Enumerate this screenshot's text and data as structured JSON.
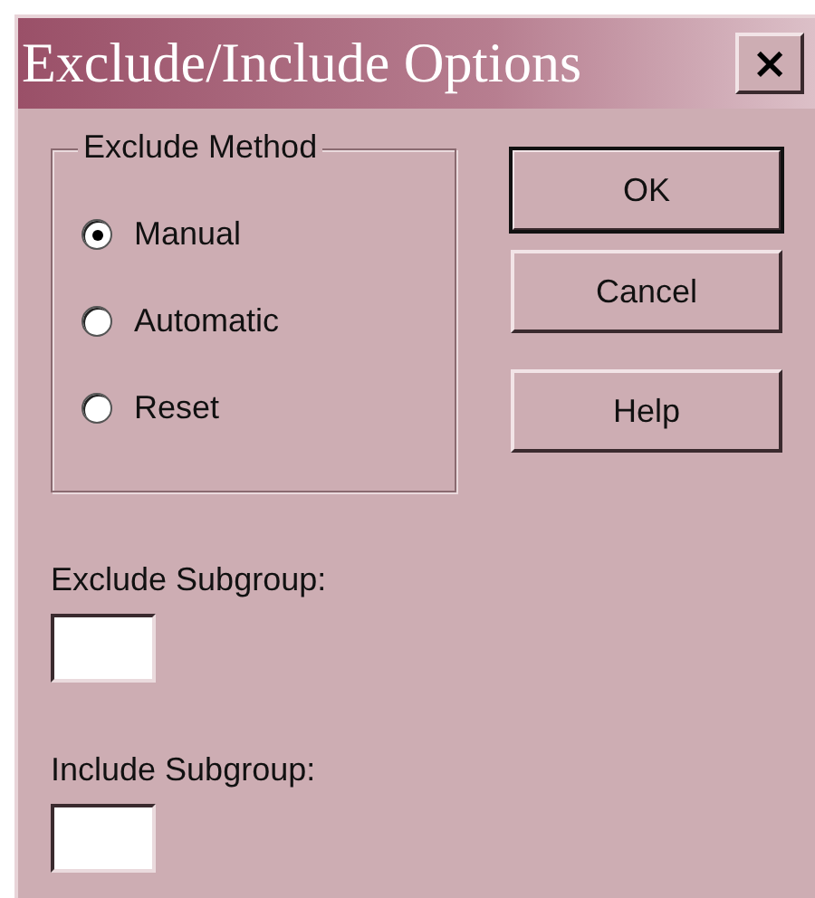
{
  "window": {
    "title": "Exclude/Include Options",
    "close": "×"
  },
  "method_group": {
    "label": "Exclude Method",
    "options": [
      {
        "label": "Manual",
        "selected": true
      },
      {
        "label": "Automatic",
        "selected": false
      },
      {
        "label": "Reset",
        "selected": false
      }
    ]
  },
  "buttons": [
    {
      "label": "OK",
      "default": true
    },
    {
      "label": "Cancel",
      "default": false
    },
    {
      "label": "Help",
      "default": false
    }
  ],
  "fields": [
    {
      "label": "Exclude Subgroup:"
    },
    {
      "label": "Include Subgroup:"
    }
  ]
}
